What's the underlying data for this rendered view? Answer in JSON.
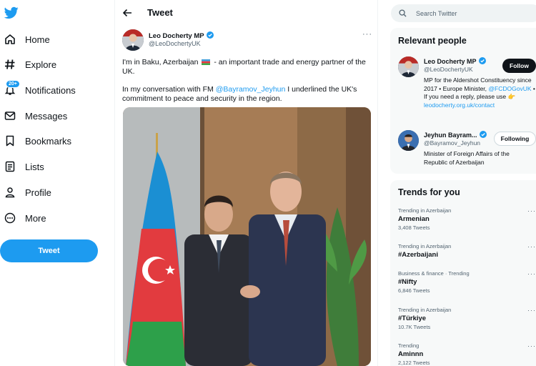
{
  "nav": {
    "items": [
      {
        "label": "Home",
        "icon": "home-icon"
      },
      {
        "label": "Explore",
        "icon": "hashtag-icon"
      },
      {
        "label": "Notifications",
        "icon": "bell-icon",
        "badge": "20+"
      },
      {
        "label": "Messages",
        "icon": "envelope-icon"
      },
      {
        "label": "Bookmarks",
        "icon": "bookmark-icon"
      },
      {
        "label": "Lists",
        "icon": "list-icon"
      },
      {
        "label": "Profile",
        "icon": "person-icon"
      },
      {
        "label": "More",
        "icon": "more-circle-icon"
      }
    ],
    "tweet_button": "Tweet"
  },
  "header": {
    "title": "Tweet"
  },
  "tweet": {
    "author_name": "Leo Docherty MP",
    "author_handle": "@LeoDochertyUK",
    "text_1_a": "I'm in Baku, Azerbaijan",
    "text_1_b": "- an important trade and energy partner of the UK.",
    "text_2_a": "In my conversation with FM",
    "text_2_mention": "@Bayramov_Jeyhun",
    "text_2_b": "I underlined the UK's commitment to peace and security in the region.",
    "more": "···"
  },
  "search": {
    "placeholder": "Search Twitter"
  },
  "relevant": {
    "title": "Relevant people",
    "people": [
      {
        "name": "Leo Docherty MP",
        "handle": "@LeoDochertyUK",
        "button": "Follow",
        "bio_1": "MP for the Aldershot Constituency since 2017 • Europe Minister,",
        "bio_mention": "@FCDOGovUK",
        "bio_2": "• If you need a reply, please use 👉",
        "bio_link": "leodocherty.org.uk/contact"
      },
      {
        "name": "Jeyhun Bayram...",
        "handle": "@Bayramov_Jeyhun",
        "button": "Following",
        "bio": "Minister of Foreign Affairs of the Republic of Azerbaijan"
      }
    ]
  },
  "trends": {
    "title": "Trends for you",
    "items": [
      {
        "context": "Trending in Azerbaijan",
        "name": "Armenian",
        "count": "3,408 Tweets"
      },
      {
        "context": "Trending in Azerbaijan",
        "name": "#Azerbaijani",
        "count": ""
      },
      {
        "context": "Business & finance · Trending",
        "name": "#Nifty",
        "count": "6,846 Tweets"
      },
      {
        "context": "Trending in Azerbaijan",
        "name": "#Türkiye",
        "count": "10.7K Tweets"
      },
      {
        "context": "Trending",
        "name": "Aminnn",
        "count": "2,122 Tweets"
      }
    ],
    "more": "···"
  },
  "colors": {
    "accent": "#1d9bf0",
    "text": "#0f1419",
    "muted": "#536471"
  }
}
